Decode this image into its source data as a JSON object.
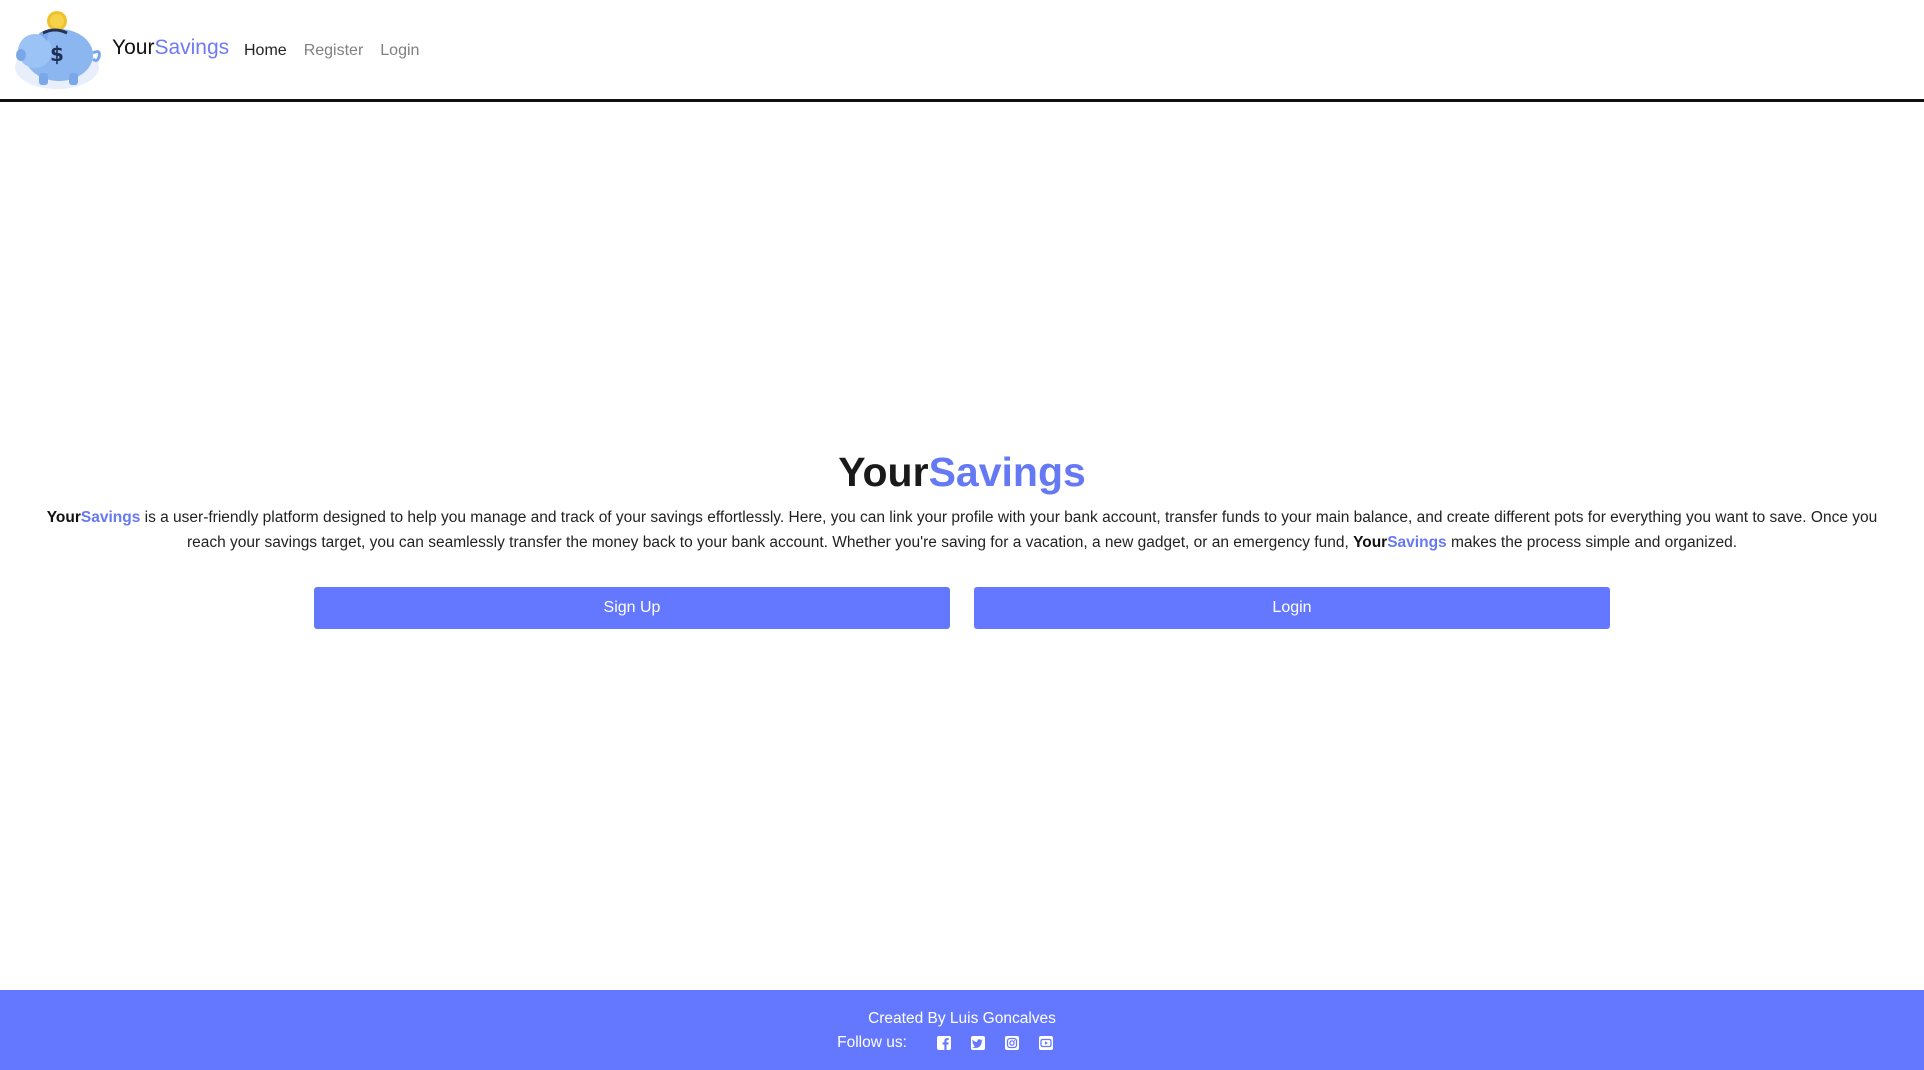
{
  "header": {
    "brand_first": "Your",
    "brand_second": "Savings",
    "logo_icon": "piggy-bank-icon",
    "nav": [
      {
        "label": "Home",
        "active": true
      },
      {
        "label": "Register",
        "active": false
      },
      {
        "label": "Login",
        "active": false
      }
    ]
  },
  "hero": {
    "title_first": "Your",
    "title_second": "Savings",
    "desc_brand_first": "Your",
    "desc_brand_second": "Savings",
    "desc_part1": " is a user-friendly platform designed to help you manage and track of your savings effortlessly. Here, you can link your profile with your bank account, transfer funds to your main balance, and create different pots for everything you want to save. Once you reach your savings target, you can seamlessly transfer the money back to your bank account. Whether you're saving for a vacation, a new gadget, or an emergency fund, ",
    "desc_part2": " makes the process simple and organized.",
    "signup_label": "Sign Up",
    "login_label": "Login"
  },
  "footer": {
    "credit": "Created By Luis Goncalves",
    "follow_label": "Follow us:",
    "social_icons": [
      "facebook-icon",
      "twitter-icon",
      "instagram-icon",
      "youtube-icon"
    ]
  },
  "colors": {
    "accent": "#6679f4",
    "button": "#6478ff",
    "footer_bg": "#6478ff",
    "text": "#212529"
  }
}
